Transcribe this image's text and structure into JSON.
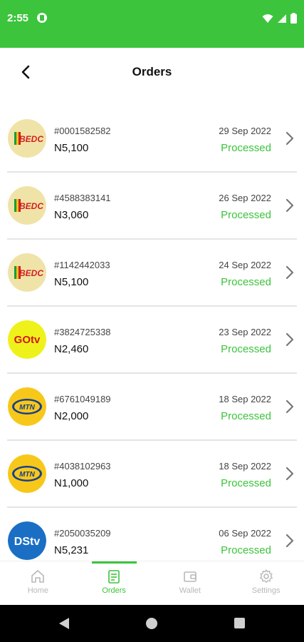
{
  "status_bar": {
    "time": "2:55"
  },
  "header": {
    "title": "Orders"
  },
  "orders": [
    {
      "id": "#0001582582",
      "amount": "N5,100",
      "date": "29 Sep 2022",
      "status": "Processed",
      "provider_icon": "bedc-logo-icon"
    },
    {
      "id": "#4588383141",
      "amount": "N3,060",
      "date": "26 Sep 2022",
      "status": "Processed",
      "provider_icon": "bedc-logo-icon"
    },
    {
      "id": "#1142442033",
      "amount": "N5,100",
      "date": "24 Sep 2022",
      "status": "Processed",
      "provider_icon": "bedc-logo-icon"
    },
    {
      "id": "#3824725338",
      "amount": "N2,460",
      "date": "23 Sep 2022",
      "status": "Processed",
      "provider_icon": "gotv-logo-icon"
    },
    {
      "id": "#6761049189",
      "amount": "N2,000",
      "date": "18 Sep 2022",
      "status": "Processed",
      "provider_icon": "mtn-logo-icon"
    },
    {
      "id": "#4038102963",
      "amount": "N1,000",
      "date": "18 Sep 2022",
      "status": "Processed",
      "provider_icon": "mtn-logo-icon"
    },
    {
      "id": "#2050035209",
      "amount": "N5,231",
      "date": "06 Sep 2022",
      "status": "Processed",
      "provider_icon": "dstv-logo-icon"
    }
  ],
  "bottom_nav": {
    "items": [
      {
        "label": "Home",
        "icon": "home-icon"
      },
      {
        "label": "Orders",
        "icon": "orders-icon",
        "active": true
      },
      {
        "label": "Wallet",
        "icon": "wallet-icon"
      },
      {
        "label": "Settings",
        "icon": "settings-icon"
      }
    ]
  },
  "colors": {
    "brand_green": "#3cc43c",
    "divider": "#e4e4e4",
    "inactive_nav": "#b8b8b8"
  }
}
